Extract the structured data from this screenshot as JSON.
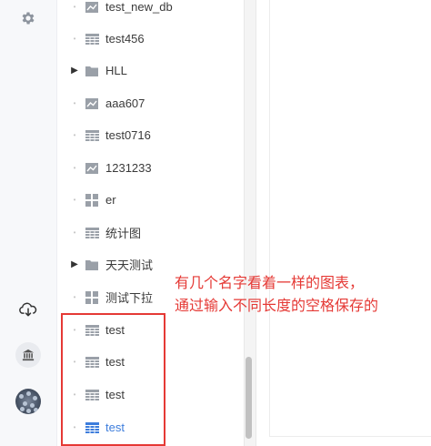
{
  "rail": {
    "icons": [
      "gear-icon",
      "cloud-download-icon",
      "bank-icon",
      "avatar"
    ]
  },
  "tree": {
    "items": [
      {
        "label": "test_new_db",
        "icon": "line-chart-icon",
        "folder": false
      },
      {
        "label": "test456",
        "icon": "table-icon",
        "folder": false
      },
      {
        "label": "HLL",
        "icon": "folder-icon",
        "folder": true
      },
      {
        "label": "aaa607",
        "icon": "line-chart-icon",
        "folder": false
      },
      {
        "label": "test0716",
        "icon": "table-icon",
        "folder": false
      },
      {
        "label": "1231233",
        "icon": "line-chart-icon",
        "folder": false
      },
      {
        "label": "er",
        "icon": "dashboard-icon",
        "folder": false
      },
      {
        "label": "统计图",
        "icon": "table-icon",
        "folder": false
      },
      {
        "label": "天天测试",
        "icon": "folder-icon",
        "folder": true
      },
      {
        "label": "测试下拉",
        "icon": "dashboard-icon",
        "folder": false
      },
      {
        "label": "test",
        "icon": "table-icon",
        "folder": false
      },
      {
        "label": "test",
        "icon": "table-icon",
        "folder": false
      },
      {
        "label": "test",
        "icon": "table-icon",
        "folder": false
      },
      {
        "label": "test",
        "icon": "table-icon",
        "folder": false,
        "active": true
      }
    ]
  },
  "annotation": {
    "line1": "有几个名字看着一样的图表，",
    "line2": "通过输入不同长度的空格保存的"
  },
  "colors": {
    "annotation": "#e53935",
    "active": "#3d7ddc",
    "icon": "#9aa0a8"
  }
}
